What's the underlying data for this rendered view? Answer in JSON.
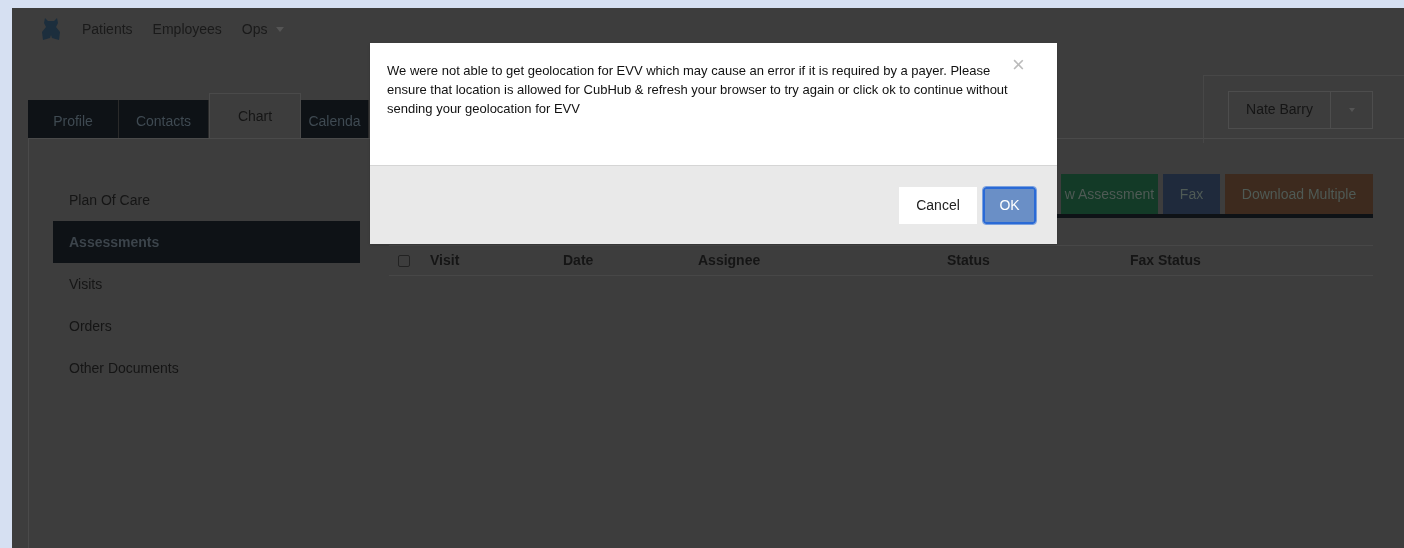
{
  "navbar": {
    "links": [
      {
        "label": "Patients",
        "dropdown": false
      },
      {
        "label": "Employees",
        "dropdown": false
      },
      {
        "label": "Ops",
        "dropdown": true
      }
    ]
  },
  "tabs": [
    {
      "label": "Profile",
      "selected": false
    },
    {
      "label": "Contacts",
      "selected": false
    },
    {
      "label": "Chart",
      "selected": true
    },
    {
      "label": "Calenda",
      "selected": false
    }
  ],
  "user_menu": {
    "name": "Nate Barry"
  },
  "sidebar": {
    "items": [
      {
        "label": "Plan Of Care",
        "selected": false
      },
      {
        "label": "Assessments",
        "selected": true
      },
      {
        "label": "Visits",
        "selected": false
      },
      {
        "label": "Orders",
        "selected": false
      },
      {
        "label": "Other Documents",
        "selected": false
      }
    ]
  },
  "actions": [
    {
      "label": "w Assessment",
      "color": "#133a27"
    },
    {
      "label": "Fax",
      "color": "#1f2a3c"
    },
    {
      "label": "Download Multiple",
      "color": "#3d2a1e"
    }
  ],
  "table": {
    "select_all_checked": false,
    "columns": [
      "Visit",
      "Date",
      "Assignee",
      "Status",
      "Fax Status"
    ]
  },
  "dialog": {
    "message": "We were not able to get geolocation for EVV which may cause an error if it is required by a payer. Please ensure that location is allowed for CubHub & refresh your browser to try again or click ok to continue without sending your geolocation for EVV",
    "close": "×",
    "buttons": [
      {
        "label": "Cancel",
        "kind": "secondary"
      },
      {
        "label": "OK",
        "kind": "primary"
      }
    ]
  }
}
